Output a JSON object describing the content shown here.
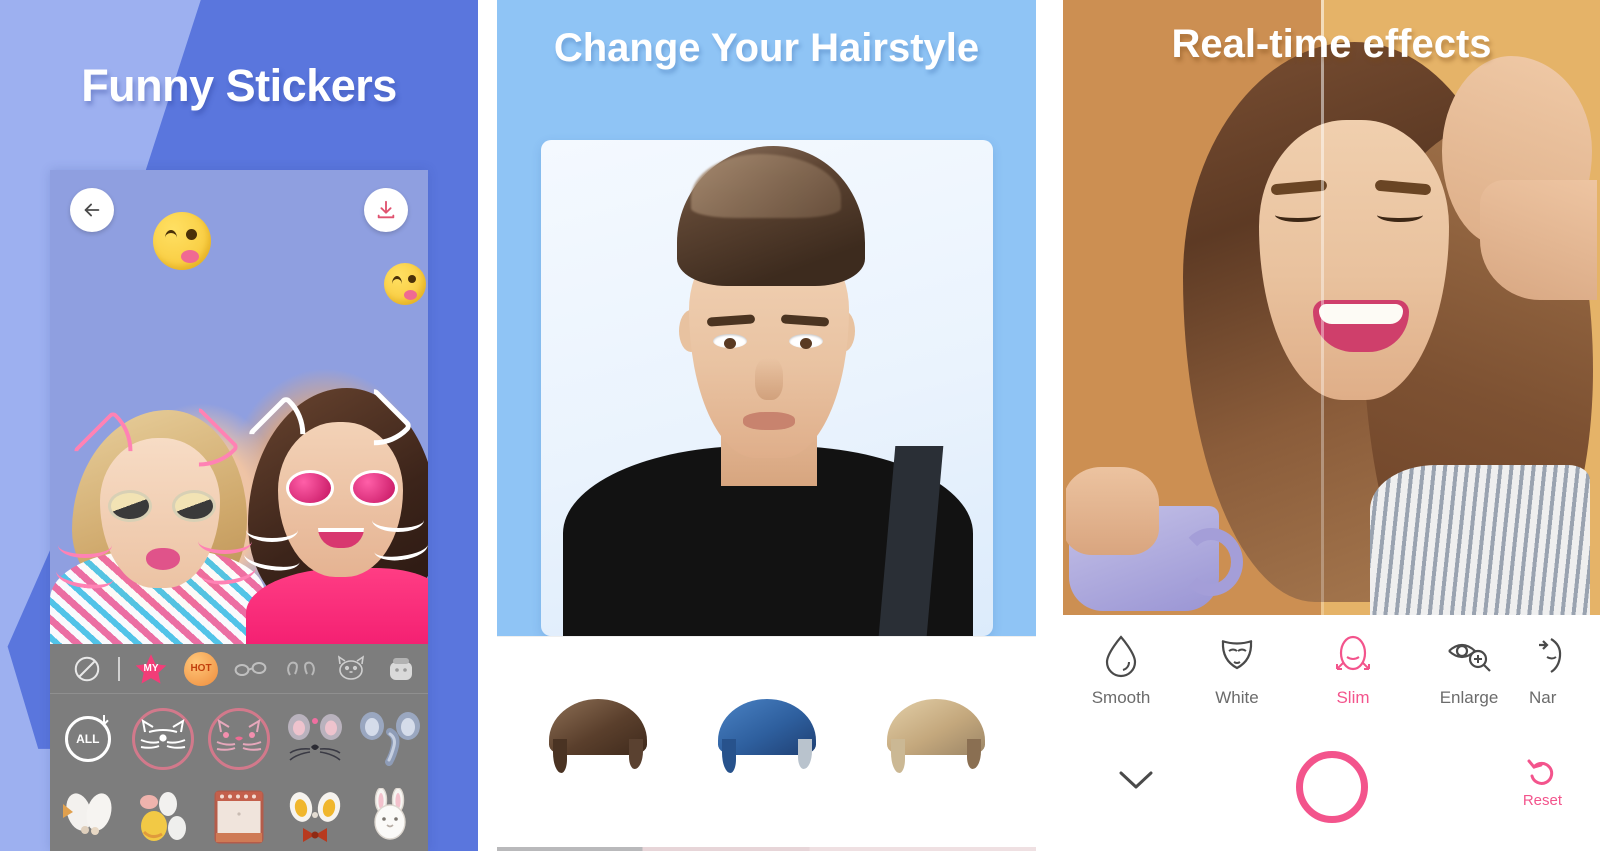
{
  "panels": [
    {
      "id": "funny-stickers",
      "title": "Funny Stickers",
      "theme": {
        "bg_light": "#9db0f0",
        "bg_dark": "#5a76dd",
        "screen": "#8f9fe0",
        "toolbar": "#7d7d7d"
      },
      "nav": {
        "back_icon": "back-arrow-icon",
        "save_icon": "download-icon"
      },
      "sticker_tabs": [
        {
          "name": "none",
          "label": "",
          "icon": "no-sticker-icon"
        },
        {
          "name": "divider",
          "label": "",
          "icon": "divider"
        },
        {
          "name": "my",
          "label": "MY",
          "icon": "star-icon"
        },
        {
          "name": "hot",
          "label": "HOT",
          "icon": "hot-badge-icon"
        },
        {
          "name": "glasses",
          "label": "",
          "icon": "glasses-icon"
        },
        {
          "name": "ears",
          "label": "",
          "icon": "ears-icon"
        },
        {
          "name": "cat",
          "label": "",
          "icon": "cat-face-icon"
        },
        {
          "name": "bunny-pack",
          "label": "",
          "icon": "sticker-pack-icon"
        }
      ],
      "sticker_grid": [
        {
          "name": "all",
          "label": "ALL",
          "icon": "all-download-icon",
          "selected": false
        },
        {
          "name": "cat-white",
          "label": "",
          "icon": "cat-white-sticker",
          "selected": true
        },
        {
          "name": "cat-pink",
          "label": "",
          "icon": "cat-pink-sticker",
          "selected": true
        },
        {
          "name": "mouse",
          "label": "",
          "icon": "mouse-sticker",
          "selected": false
        },
        {
          "name": "elephant",
          "label": "",
          "icon": "elephant-sticker",
          "selected": false
        },
        {
          "name": "bunny-ears",
          "label": "",
          "icon": "bunny-ears-sticker",
          "selected": false
        },
        {
          "name": "eggs",
          "label": "",
          "icon": "easter-eggs-sticker",
          "selected": false
        },
        {
          "name": "frame",
          "label": "",
          "icon": "photo-frame-sticker",
          "selected": false
        },
        {
          "name": "dog-bowtie",
          "label": "",
          "icon": "dog-bowtie-sticker",
          "selected": false
        },
        {
          "name": "rabbit",
          "label": "",
          "icon": "rabbit-sticker",
          "selected": false
        }
      ],
      "emojis": [
        {
          "name": "kissing-wink-emoji-1"
        },
        {
          "name": "kissing-wink-emoji-2"
        }
      ]
    },
    {
      "id": "change-hairstyle",
      "title": "Change Your Hairstyle",
      "theme": {
        "bg": "#8fc4f5",
        "canvas": "#f4f9ff",
        "tray": "#ffffff"
      },
      "hair_options": [
        {
          "name": "hair-brown-pompadour",
          "color": "#6b4b33",
          "highlight": "#b9936c"
        },
        {
          "name": "hair-blue-spiky",
          "color": "#2f5e9e",
          "highlight": "#4d86c9"
        },
        {
          "name": "hair-blonde-quiff",
          "color": "#c9ad82",
          "highlight": "#e4d2ae"
        }
      ]
    },
    {
      "id": "real-time-effects",
      "title": "Real-time effects",
      "theme": {
        "bg_left": "#cc8f52",
        "bg_right": "#e5b368",
        "panel": "#ffffff",
        "accent": "#f3548c"
      },
      "effects": [
        {
          "name": "smooth",
          "label": "Smooth",
          "icon": "water-drop-icon",
          "active": false
        },
        {
          "name": "white",
          "label": "White",
          "icon": "face-white-icon",
          "active": false
        },
        {
          "name": "slim",
          "label": "Slim",
          "icon": "face-slim-icon",
          "active": true
        },
        {
          "name": "enlarge",
          "label": "Enlarge",
          "icon": "eye-enlarge-icon",
          "active": false
        },
        {
          "name": "narrow",
          "label": "Nar",
          "icon": "face-narrow-icon",
          "active": false
        }
      ],
      "controls": {
        "collapse": {
          "name": "collapse",
          "label": "",
          "icon": "chevron-down-icon"
        },
        "shutter": {
          "name": "shutter",
          "label": "",
          "icon": "shutter-circle-icon"
        },
        "reset": {
          "name": "reset",
          "label": "Reset",
          "icon": "undo-icon"
        }
      }
    }
  ]
}
